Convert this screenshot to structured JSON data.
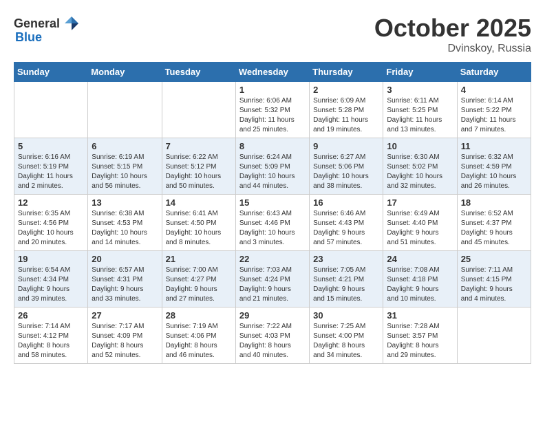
{
  "header": {
    "logo_general": "General",
    "logo_blue": "Blue",
    "month": "October 2025",
    "location": "Dvinskoy, Russia"
  },
  "weekdays": [
    "Sunday",
    "Monday",
    "Tuesday",
    "Wednesday",
    "Thursday",
    "Friday",
    "Saturday"
  ],
  "weeks": [
    [
      {
        "day": "",
        "info": ""
      },
      {
        "day": "",
        "info": ""
      },
      {
        "day": "",
        "info": ""
      },
      {
        "day": "1",
        "info": "Sunrise: 6:06 AM\nSunset: 5:32 PM\nDaylight: 11 hours\nand 25 minutes."
      },
      {
        "day": "2",
        "info": "Sunrise: 6:09 AM\nSunset: 5:28 PM\nDaylight: 11 hours\nand 19 minutes."
      },
      {
        "day": "3",
        "info": "Sunrise: 6:11 AM\nSunset: 5:25 PM\nDaylight: 11 hours\nand 13 minutes."
      },
      {
        "day": "4",
        "info": "Sunrise: 6:14 AM\nSunset: 5:22 PM\nDaylight: 11 hours\nand 7 minutes."
      }
    ],
    [
      {
        "day": "5",
        "info": "Sunrise: 6:16 AM\nSunset: 5:19 PM\nDaylight: 11 hours\nand 2 minutes."
      },
      {
        "day": "6",
        "info": "Sunrise: 6:19 AM\nSunset: 5:15 PM\nDaylight: 10 hours\nand 56 minutes."
      },
      {
        "day": "7",
        "info": "Sunrise: 6:22 AM\nSunset: 5:12 PM\nDaylight: 10 hours\nand 50 minutes."
      },
      {
        "day": "8",
        "info": "Sunrise: 6:24 AM\nSunset: 5:09 PM\nDaylight: 10 hours\nand 44 minutes."
      },
      {
        "day": "9",
        "info": "Sunrise: 6:27 AM\nSunset: 5:06 PM\nDaylight: 10 hours\nand 38 minutes."
      },
      {
        "day": "10",
        "info": "Sunrise: 6:30 AM\nSunset: 5:02 PM\nDaylight: 10 hours\nand 32 minutes."
      },
      {
        "day": "11",
        "info": "Sunrise: 6:32 AM\nSunset: 4:59 PM\nDaylight: 10 hours\nand 26 minutes."
      }
    ],
    [
      {
        "day": "12",
        "info": "Sunrise: 6:35 AM\nSunset: 4:56 PM\nDaylight: 10 hours\nand 20 minutes."
      },
      {
        "day": "13",
        "info": "Sunrise: 6:38 AM\nSunset: 4:53 PM\nDaylight: 10 hours\nand 14 minutes."
      },
      {
        "day": "14",
        "info": "Sunrise: 6:41 AM\nSunset: 4:50 PM\nDaylight: 10 hours\nand 8 minutes."
      },
      {
        "day": "15",
        "info": "Sunrise: 6:43 AM\nSunset: 4:46 PM\nDaylight: 10 hours\nand 3 minutes."
      },
      {
        "day": "16",
        "info": "Sunrise: 6:46 AM\nSunset: 4:43 PM\nDaylight: 9 hours\nand 57 minutes."
      },
      {
        "day": "17",
        "info": "Sunrise: 6:49 AM\nSunset: 4:40 PM\nDaylight: 9 hours\nand 51 minutes."
      },
      {
        "day": "18",
        "info": "Sunrise: 6:52 AM\nSunset: 4:37 PM\nDaylight: 9 hours\nand 45 minutes."
      }
    ],
    [
      {
        "day": "19",
        "info": "Sunrise: 6:54 AM\nSunset: 4:34 PM\nDaylight: 9 hours\nand 39 minutes."
      },
      {
        "day": "20",
        "info": "Sunrise: 6:57 AM\nSunset: 4:31 PM\nDaylight: 9 hours\nand 33 minutes."
      },
      {
        "day": "21",
        "info": "Sunrise: 7:00 AM\nSunset: 4:27 PM\nDaylight: 9 hours\nand 27 minutes."
      },
      {
        "day": "22",
        "info": "Sunrise: 7:03 AM\nSunset: 4:24 PM\nDaylight: 9 hours\nand 21 minutes."
      },
      {
        "day": "23",
        "info": "Sunrise: 7:05 AM\nSunset: 4:21 PM\nDaylight: 9 hours\nand 15 minutes."
      },
      {
        "day": "24",
        "info": "Sunrise: 7:08 AM\nSunset: 4:18 PM\nDaylight: 9 hours\nand 10 minutes."
      },
      {
        "day": "25",
        "info": "Sunrise: 7:11 AM\nSunset: 4:15 PM\nDaylight: 9 hours\nand 4 minutes."
      }
    ],
    [
      {
        "day": "26",
        "info": "Sunrise: 7:14 AM\nSunset: 4:12 PM\nDaylight: 8 hours\nand 58 minutes."
      },
      {
        "day": "27",
        "info": "Sunrise: 7:17 AM\nSunset: 4:09 PM\nDaylight: 8 hours\nand 52 minutes."
      },
      {
        "day": "28",
        "info": "Sunrise: 7:19 AM\nSunset: 4:06 PM\nDaylight: 8 hours\nand 46 minutes."
      },
      {
        "day": "29",
        "info": "Sunrise: 7:22 AM\nSunset: 4:03 PM\nDaylight: 8 hours\nand 40 minutes."
      },
      {
        "day": "30",
        "info": "Sunrise: 7:25 AM\nSunset: 4:00 PM\nDaylight: 8 hours\nand 34 minutes."
      },
      {
        "day": "31",
        "info": "Sunrise: 7:28 AM\nSunset: 3:57 PM\nDaylight: 8 hours\nand 29 minutes."
      },
      {
        "day": "",
        "info": ""
      }
    ]
  ]
}
